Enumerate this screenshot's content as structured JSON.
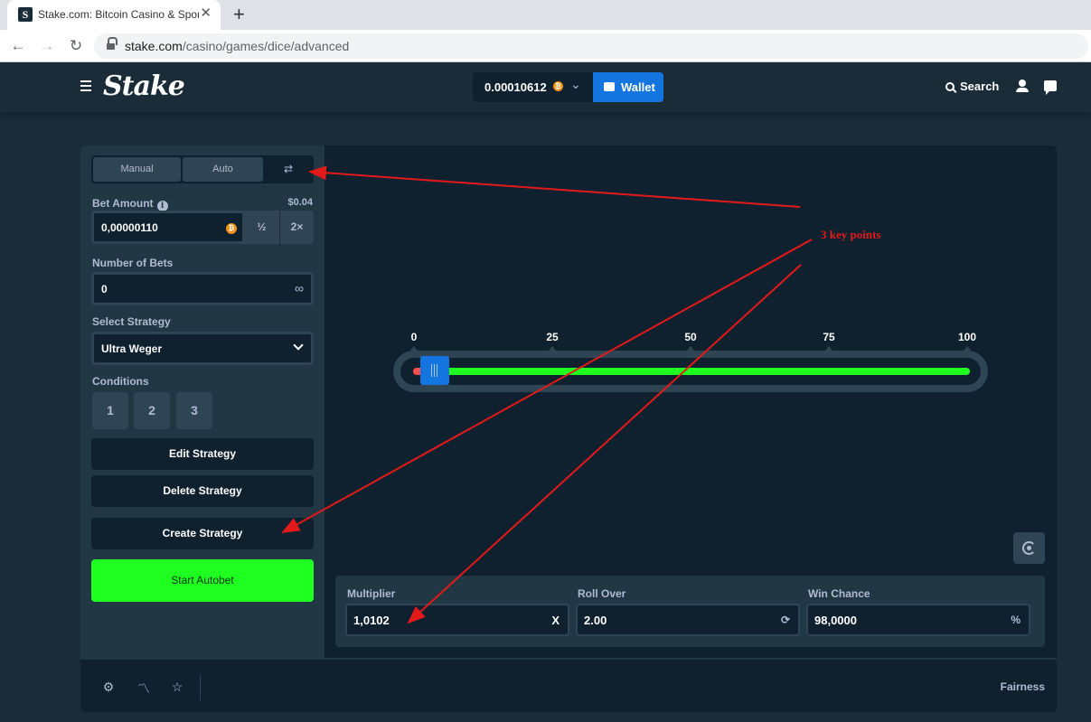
{
  "browser": {
    "tab_title": "Stake.com: Bitcoin Casino & Sports",
    "tab_close": "✕",
    "new_tab": "+",
    "url_host": "stake.com",
    "url_path": "/casino/games/dice/advanced"
  },
  "header": {
    "logo": "Stake",
    "balance": "0.00010612",
    "wallet_label": "Wallet",
    "search_label": "Search"
  },
  "sidebar": {
    "tabs": [
      "Manual",
      "Auto",
      "⇄"
    ],
    "bet_amount_label": "Bet Amount",
    "bet_amount_usd": "$0.04",
    "bet_amount_value": "0,00000110",
    "half_label": "½",
    "double_label": "2×",
    "number_of_bets_label": "Number of Bets",
    "number_of_bets_value": "0",
    "strategy_label": "Select Strategy",
    "strategy_value": "Ultra Weger",
    "conditions_label": "Conditions",
    "conditions": [
      "1",
      "2",
      "3"
    ],
    "edit_strategy": "Edit Strategy",
    "delete_strategy": "Delete Strategy",
    "create_strategy": "Create Strategy",
    "start_autobet": "Start Autobet"
  },
  "board": {
    "ticks": [
      "0",
      "25",
      "50",
      "75",
      "100"
    ],
    "roll_over": 2.0,
    "colors": {
      "win": "#1fff20",
      "lose": "#ff4e4e",
      "handle": "#1475e1"
    }
  },
  "stats": {
    "multiplier_label": "Multiplier",
    "multiplier_value": "1,0102",
    "multiplier_suffix": "X",
    "roll_over_label": "Roll Over",
    "roll_over_value": "2.00",
    "win_chance_label": "Win Chance",
    "win_chance_value": "98,0000",
    "win_chance_suffix": "%"
  },
  "footer": {
    "fairness_label": "Fairness"
  },
  "annotation": {
    "text": "3 key points"
  }
}
